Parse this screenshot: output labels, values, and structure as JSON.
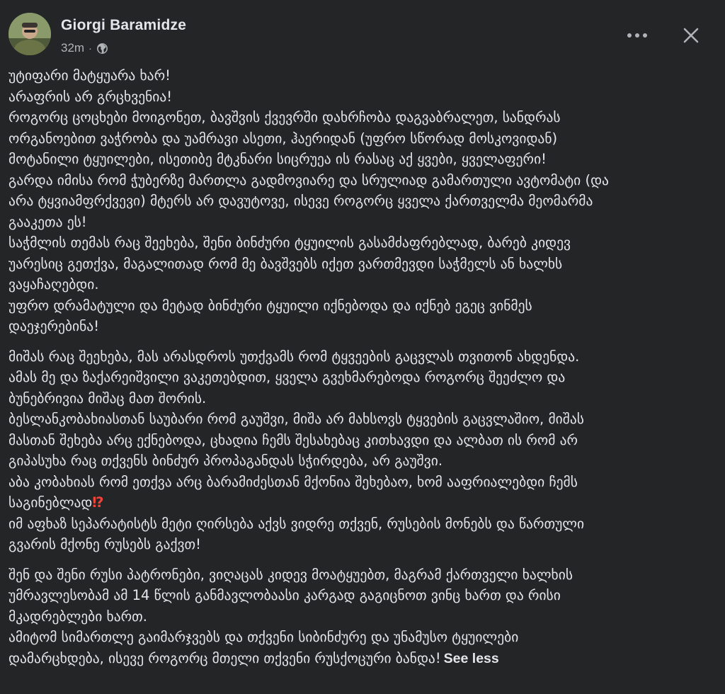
{
  "post": {
    "author": "Giorgi Baramidze",
    "time": "32m",
    "separator": "·",
    "privacy_icon": "globe-icon",
    "more_icon": "more-options-icon",
    "close_icon": "close-icon",
    "see_less": "See less",
    "emoji_icon": "exclamation-question-icon",
    "emoji_glyph": "⁉"
  },
  "paragraphs": [
    {
      "lines": [
        "უტიფარი მატყუარა ხარ!",
        "არაფრის არ გრცხვენია!",
        "როგორც ცოცხები მოიგონეთ, ბავშვის ქვევრში დახრჩობა დაგვაბრალეთ, სანდრას",
        "ორგანოებით ვაჭრობა და უამრავი ასეთი, ჰაერიდან (უფრო სწორად მოსკოვიდან)",
        "მოტანილი ტყუილები, ისეთიბე მტკნარი სიცრუეა ის რასაც აქ ყვები, ყველაფერი!",
        "გარდა იმისა რომ  ჭუბერზე მართლა გადმოვიარე და სრულიად გამართული ავტომატი (და",
        "არა ტყვიამფრქვევი) მტერს არ დავუტოვე, ისევე როგორც ყველა ქართველმა მეომარმა",
        "გააკეთა ეს!",
        "საჭმლის თემას რაც შეეხება, შენი ბინძური ტყუილის გასამძაფრებლად, ბარებ კიდევ",
        "უარესიც გეთქვა, მაგალითად რომ მე ბავშვებს იქეთ ვართმევდი საჭმელს ან ხალხს",
        "ვაყაჩაღებდი.",
        "უფრო დრამატული და მეტად ბინძური ტყუილი იქნებოდა და იქნებ ეგეც ვინმეს",
        "დაეჯერებინა!"
      ]
    },
    {
      "lines": [
        "მიშას რაც შეეხება, მას არასდროს უთქვამს რომ ტყვეების გაცვლას თვითონ ახდენდა.",
        "ამას მე და ზაქარეიშვილი ვაკეთებდით, ყველა გვეხმარებოდა როგორც შეეძლო და",
        "ბუნებრივია მიშაც მათ შორის.",
        "ბესლანკობახიასთან საუბარი რომ გაუშვი, მიშა არ მახსოვს ტყვების გაცვლაშიო, მიშას",
        "მასთან შეხება არც ექნებოდა, ცხადია ჩემს შესახებაც კითხავდი და ალბათ ის რომ არ",
        "გიპასუხა რაც თქვენს ბინძურ პროპაგანდას სჭირდება, არ გაუშვი.",
        "აბა კობახიას რომ ეთქვა არც ბარამიძესთან მქონია შეხებაო, ხომ ააფრიალებდი ჩემს",
        "საგინებლად",
        "იმ აფხაზ სეპარატისტს მეტი ღირსება აქვს ვიდრე თქვენ, რუსების მონებს და წართული",
        "გვარის მქონე რუსებს გაქვთ!"
      ]
    },
    {
      "lines": [
        "შენ და შენი რუსი პატრონები, ვიღაცას კიდევ მოატყუებთ, მაგრამ ქართველი ხალხის",
        "უმრავლესობამ ამ 14 წლის განმავლობაასი კარგად გაგიცნოთ ვინც ხართ და რისი",
        "მკადრებლები ხართ.",
        "ამიტომ სიმართლე გაიმარჯვებს და თქვენი სიბინძურე და უნამუსო ტყუილები",
        "დამარცხდება, ისევე როგორც მთელი თქვენი რუსქოცური ბანდა!"
      ]
    }
  ]
}
